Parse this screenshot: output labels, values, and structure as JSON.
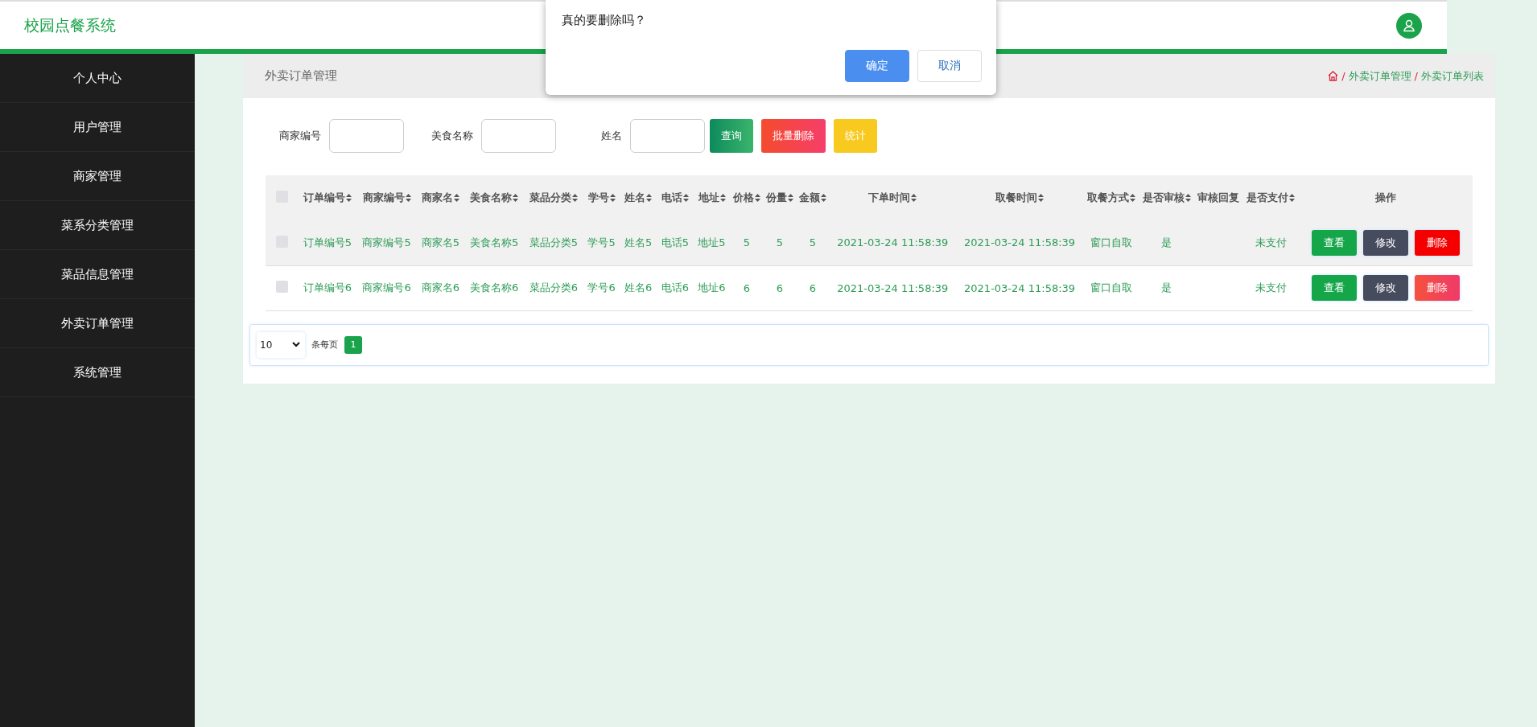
{
  "header": {
    "title": "校园点餐系统"
  },
  "sidebar": {
    "items": [
      {
        "label": "个人中心"
      },
      {
        "label": "用户管理"
      },
      {
        "label": "商家管理"
      },
      {
        "label": "菜系分类管理"
      },
      {
        "label": "菜品信息管理"
      },
      {
        "label": "外卖订单管理"
      },
      {
        "label": "系统管理"
      }
    ]
  },
  "breadcrumb": {
    "title": "外卖订单管理",
    "path": [
      {
        "separator": "/",
        "label": "外卖订单管理"
      },
      {
        "separator": "/",
        "label": "外卖订单列表"
      }
    ]
  },
  "filters": [
    {
      "label": "商家编号"
    },
    {
      "label": "美食名称"
    },
    {
      "label": "姓名"
    }
  ],
  "filter_buttons": [
    {
      "label": "查询",
      "kind": "search"
    },
    {
      "label": "批量删除",
      "kind": "danger"
    },
    {
      "label": "统计",
      "kind": "stats"
    }
  ],
  "table": {
    "select_all": {
      "checked": false
    },
    "columns": [
      {
        "label": "订单编号",
        "sortable": true
      },
      {
        "label": "商家编号",
        "sortable": true
      },
      {
        "label": "商家名",
        "sortable": true
      },
      {
        "label": "美食名称",
        "sortable": true
      },
      {
        "label": "菜品分类",
        "sortable": true
      },
      {
        "label": "学号",
        "sortable": true
      },
      {
        "label": "姓名",
        "sortable": true
      },
      {
        "label": "电话",
        "sortable": true
      },
      {
        "label": "地址",
        "sortable": true
      },
      {
        "label": "价格",
        "sortable": true
      },
      {
        "label": "份量",
        "sortable": true
      },
      {
        "label": "金额",
        "sortable": true
      },
      {
        "label": "下单时间",
        "sortable": true
      },
      {
        "label": "取餐时间",
        "sortable": true
      },
      {
        "label": "取餐方式",
        "sortable": true
      },
      {
        "label": "是否审核",
        "sortable": true
      },
      {
        "label": "审核回复",
        "sortable": false
      },
      {
        "label": "是否支付",
        "sortable": true
      },
      {
        "label": "操作",
        "sortable": false
      }
    ],
    "rows": [
      {
        "highlighted": true,
        "checked": false,
        "cells": [
          "订单编号5",
          "商家编号5",
          "商家名5",
          "美食名称5",
          "菜品分类5",
          "学号5",
          "姓名5",
          "电话5",
          "地址5",
          "5",
          "5",
          "5",
          "2021-03-24 11:58:39",
          "2021-03-24 11:58:39",
          "窗口自取",
          "是",
          "",
          "未支付"
        ],
        "actions": [
          {
            "label": "查看",
            "kind": "view"
          },
          {
            "label": "修改",
            "kind": "edit"
          },
          {
            "label": "删除",
            "kind": "delete"
          }
        ]
      },
      {
        "highlighted": false,
        "checked": false,
        "cells": [
          "订单编号6",
          "商家编号6",
          "商家名6",
          "美食名称6",
          "菜品分类6",
          "学号6",
          "姓名6",
          "电话6",
          "地址6",
          "6",
          "6",
          "6",
          "2021-03-24 11:58:39",
          "2021-03-24 11:58:39",
          "窗口自取",
          "是",
          "",
          "未支付"
        ],
        "actions": [
          {
            "label": "查看",
            "kind": "view"
          },
          {
            "label": "修改",
            "kind": "edit"
          },
          {
            "label": "删除",
            "kind": "delete"
          }
        ]
      }
    ]
  },
  "pagination": {
    "page_size": "10",
    "suffix": "条每页",
    "pages": [
      {
        "label": "1",
        "selected": true
      }
    ]
  },
  "dialog": {
    "message": "真的要删除吗？",
    "buttons": [
      {
        "label": "确定",
        "kind": "primary"
      },
      {
        "label": "取消",
        "kind": "default"
      }
    ]
  }
}
